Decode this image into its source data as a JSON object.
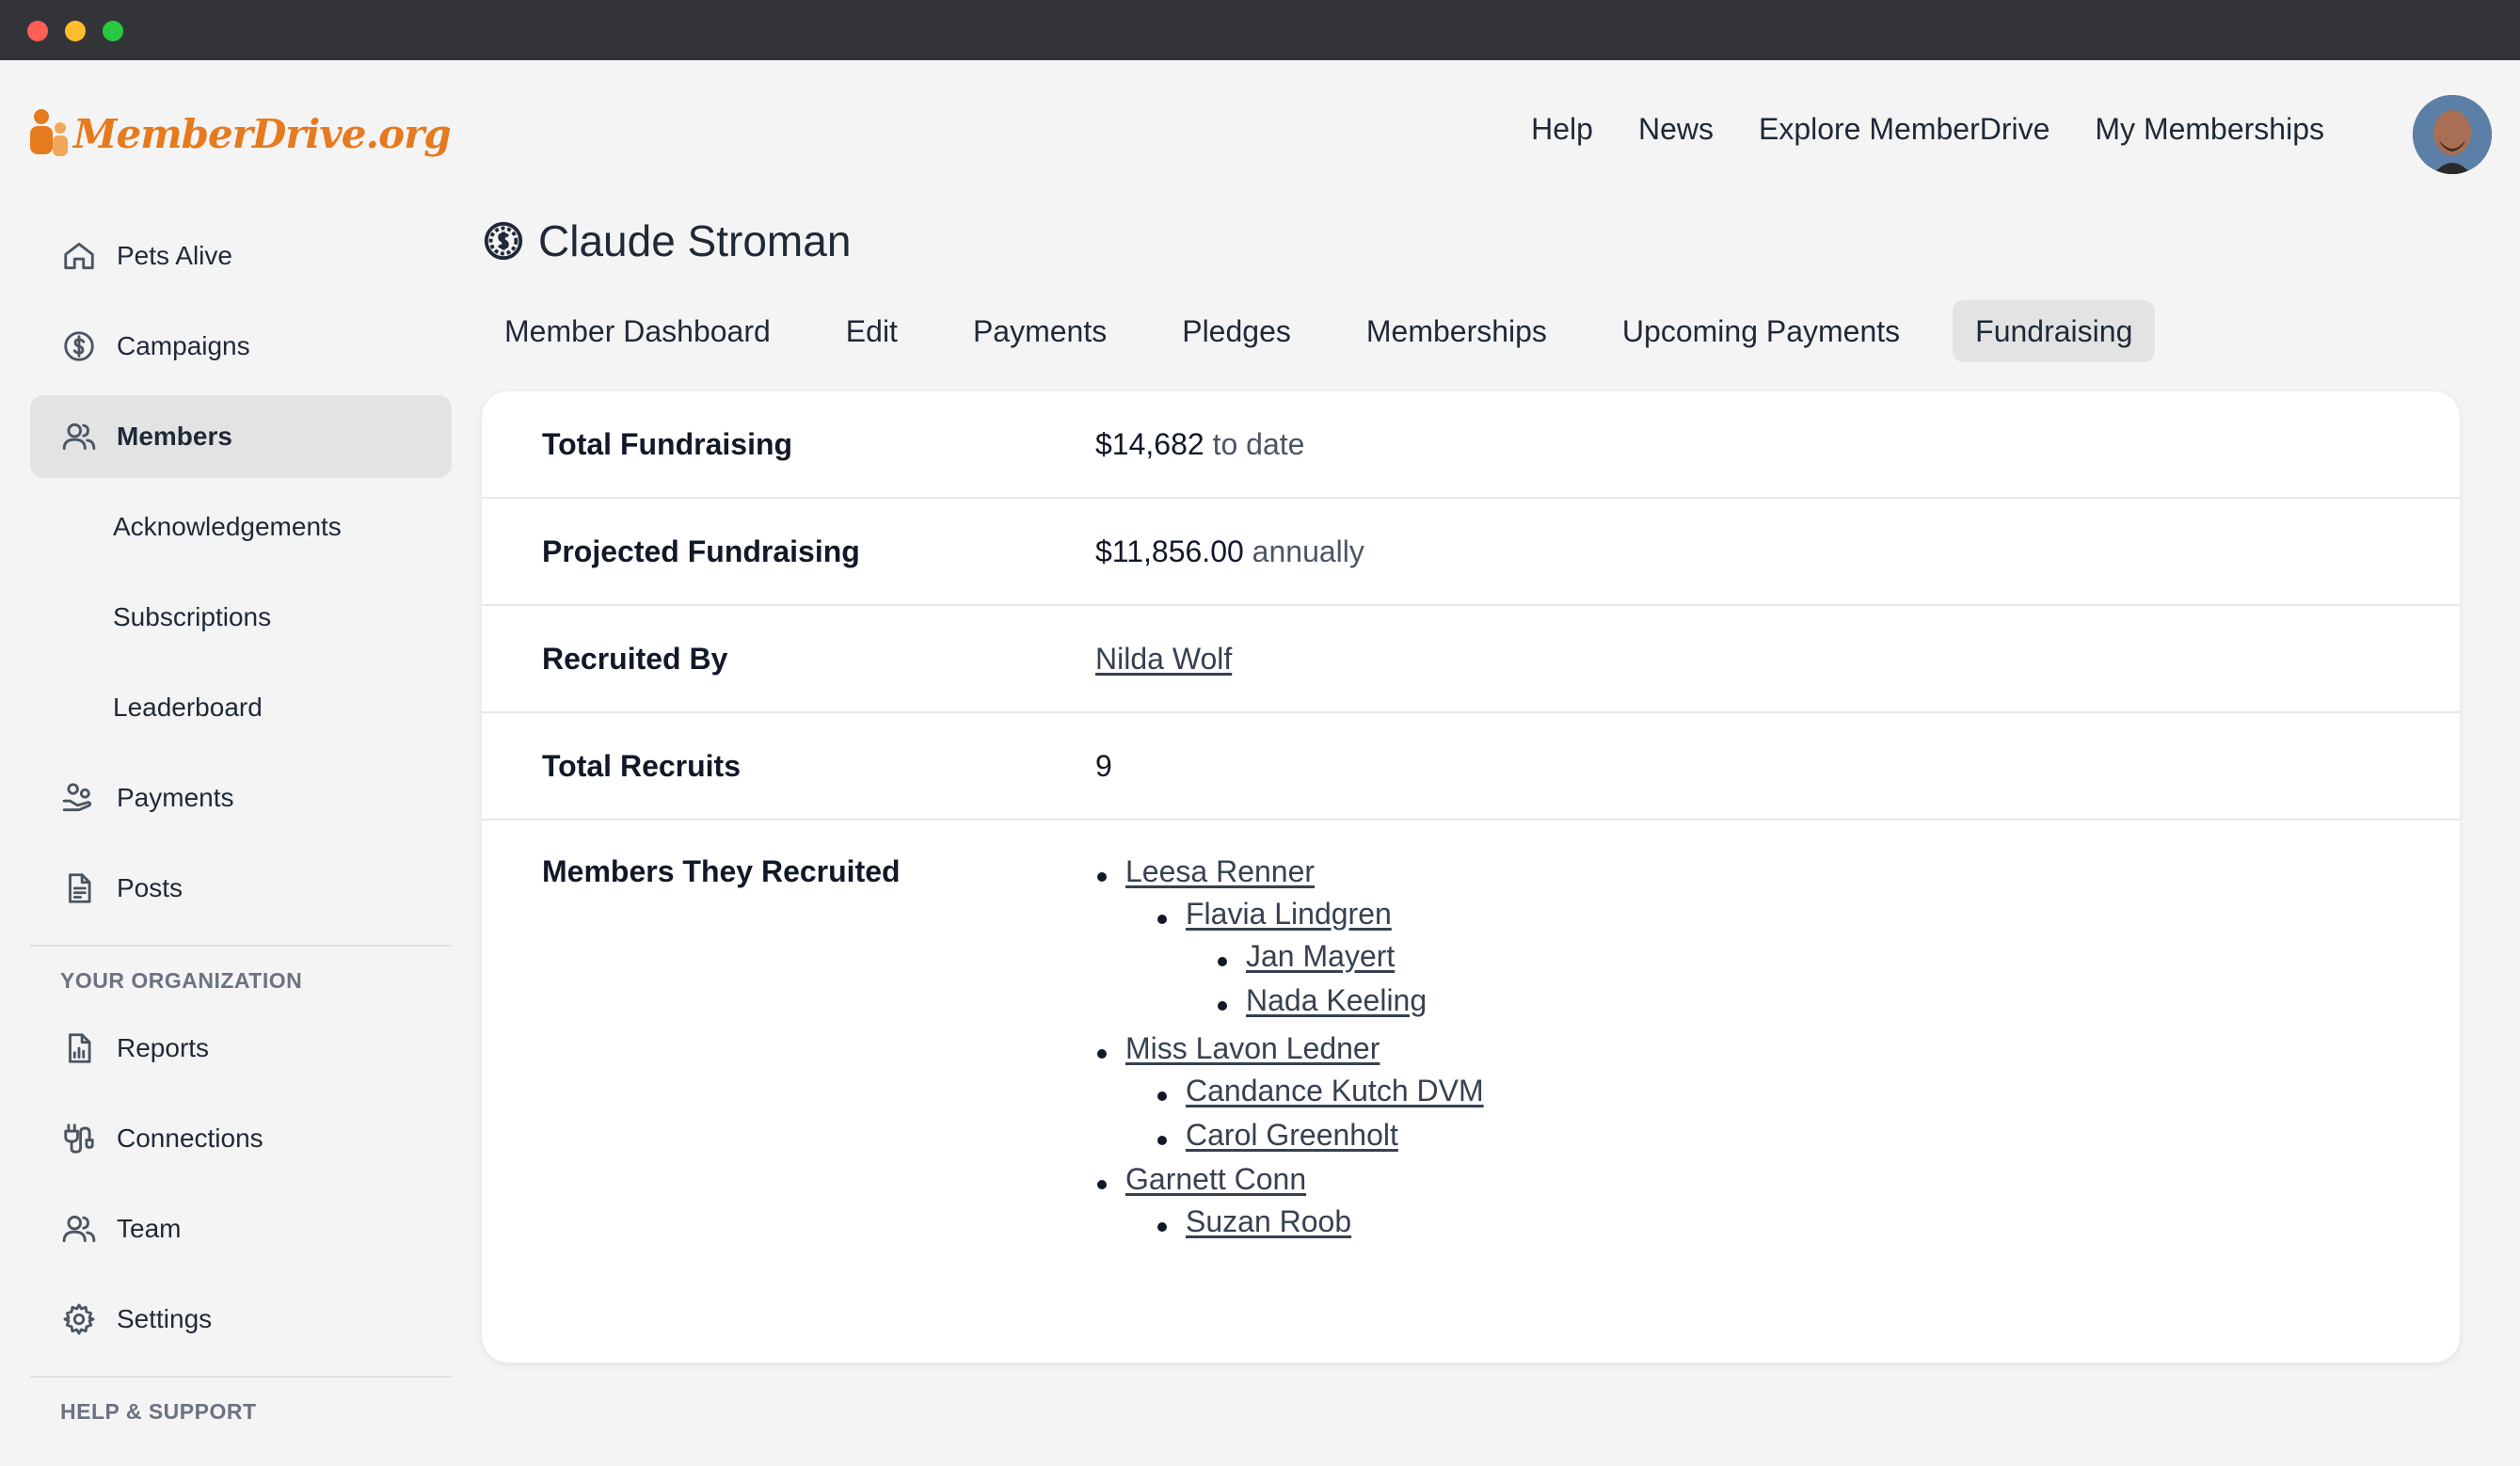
{
  "brand": {
    "name": "MemberDrive.org",
    "color": "#e67a1e"
  },
  "topnav": [
    {
      "label": "Help"
    },
    {
      "label": "News"
    },
    {
      "label": "Explore MemberDrive"
    },
    {
      "label": "My Memberships"
    }
  ],
  "sidebar": {
    "items": [
      {
        "label": "Pets Alive",
        "icon": "home-icon"
      },
      {
        "label": "Campaigns",
        "icon": "dollar-circle-icon"
      },
      {
        "label": "Members",
        "icon": "users-icon",
        "active": true
      },
      {
        "label": "Acknowledgements"
      },
      {
        "label": "Subscriptions"
      },
      {
        "label": "Leaderboard"
      },
      {
        "label": "Payments",
        "icon": "hand-coins-icon"
      },
      {
        "label": "Posts",
        "icon": "document-icon"
      }
    ],
    "org_heading": "YOUR ORGANIZATION",
    "org_items": [
      {
        "label": "Reports",
        "icon": "report-icon"
      },
      {
        "label": "Connections",
        "icon": "plug-icon"
      },
      {
        "label": "Team",
        "icon": "users-icon"
      },
      {
        "label": "Settings",
        "icon": "gear-icon"
      }
    ],
    "support_heading": "HELP & SUPPORT"
  },
  "page": {
    "title": "Claude Stroman",
    "tabs": [
      {
        "label": "Member Dashboard"
      },
      {
        "label": "Edit"
      },
      {
        "label": "Payments"
      },
      {
        "label": "Pledges"
      },
      {
        "label": "Memberships"
      },
      {
        "label": "Upcoming Payments"
      },
      {
        "label": "Fundraising",
        "active": true
      }
    ]
  },
  "fundraising": {
    "total_label": "Total Fundraising",
    "total_value": "$14,682",
    "total_suffix": "to date",
    "projected_label": "Projected Fundraising",
    "projected_value": "$11,856.00",
    "projected_suffix": "annually",
    "recruited_by_label": "Recruited By",
    "recruited_by": "Nilda Wolf",
    "total_recruits_label": "Total Recruits",
    "total_recruits": "9",
    "members_label": "Members They Recruited",
    "recruits": [
      {
        "name": "Leesa Renner",
        "children": [
          {
            "name": "Flavia Lindgren",
            "children": [
              {
                "name": "Jan Mayert"
              },
              {
                "name": "Nada Keeling"
              }
            ]
          }
        ]
      },
      {
        "name": "Miss Lavon Ledner",
        "children": [
          {
            "name": "Candance Kutch DVM"
          },
          {
            "name": "Carol Greenholt"
          }
        ]
      },
      {
        "name": "Garnett Conn",
        "children": [
          {
            "name": "Suzan Roob"
          }
        ]
      }
    ]
  }
}
